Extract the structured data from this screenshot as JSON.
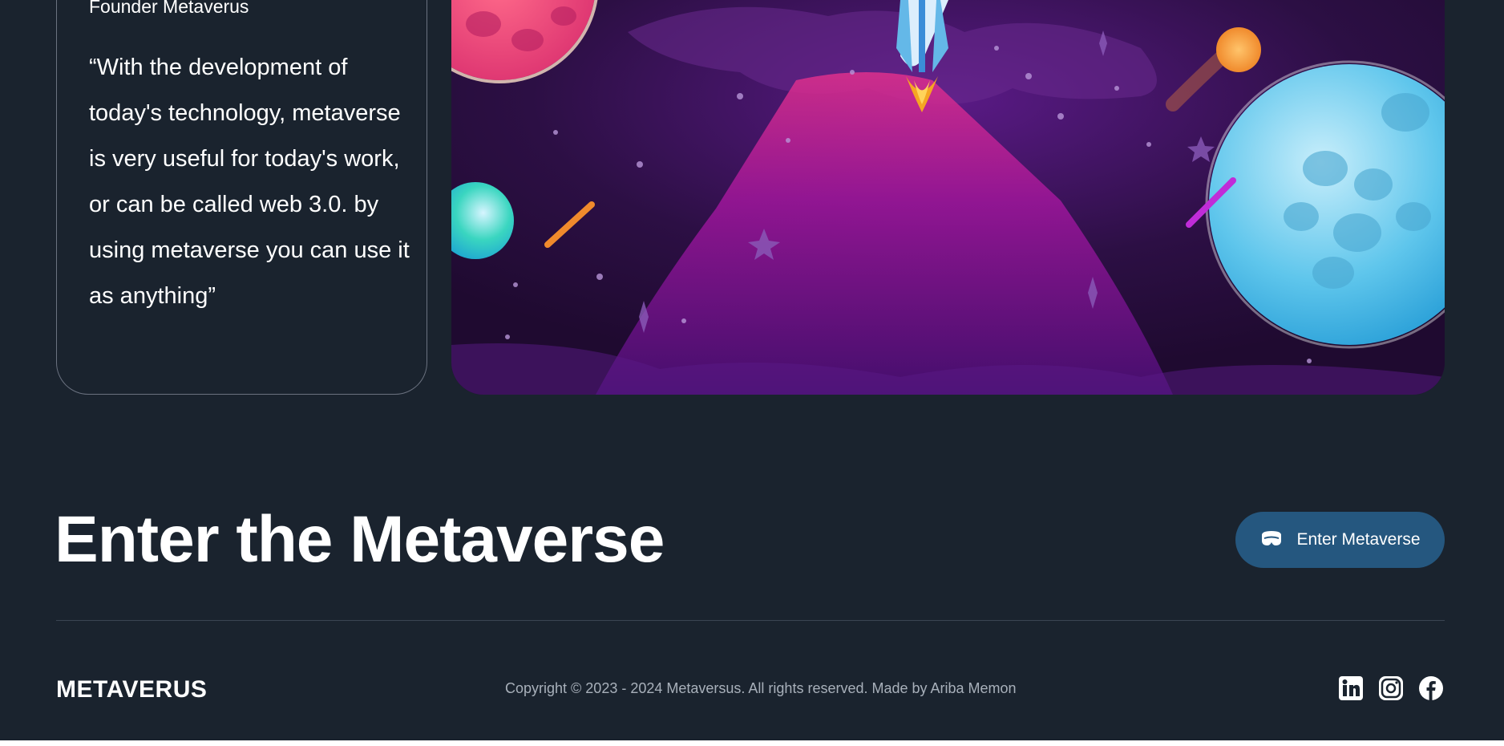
{
  "testimonial": {
    "role": "Founder Metaverus",
    "quote": "“With the development of today's technology, metaverse is very useful for today's work, or can be called web 3.0. by using metaverse you can use it as anything”"
  },
  "cta": {
    "heading": "Enter the Metaverse",
    "button_label": "Enter Metaverse",
    "button_icon": "vr-headset-icon",
    "button_color": "#25577f"
  },
  "footer": {
    "brand": "METAVERUS",
    "copyright": "Copyright © 2023 - 2024 Metaversus. All rights reserved. Made by Ariba Memon",
    "socials": [
      {
        "name": "linkedin-icon"
      },
      {
        "name": "instagram-icon"
      },
      {
        "name": "facebook-icon"
      }
    ]
  },
  "colors": {
    "background": "#1a232e",
    "accent": "#25577f"
  }
}
